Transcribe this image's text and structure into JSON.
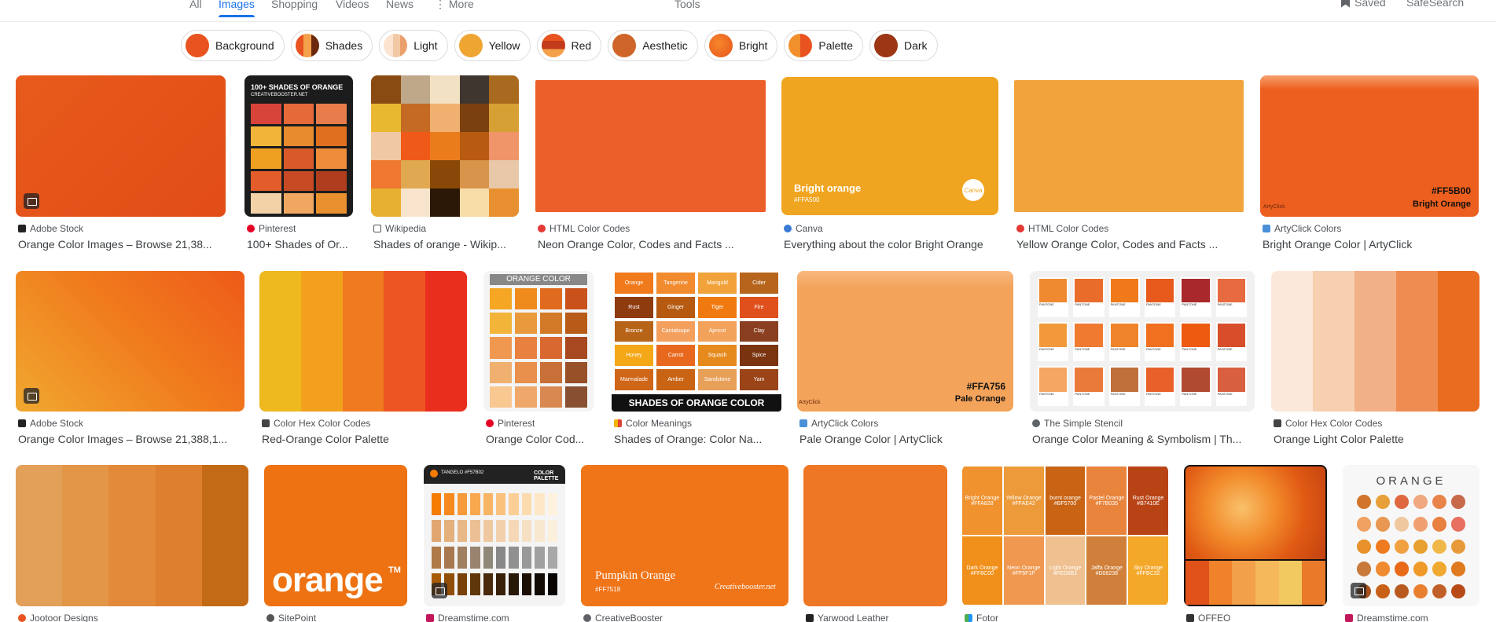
{
  "nav": {
    "tabs": [
      "All",
      "Images",
      "Shopping",
      "Videos",
      "News",
      "More"
    ],
    "active": "Images",
    "tools": "Tools",
    "saved": "Saved",
    "safesearch": "SafeSearch"
  },
  "chips": [
    {
      "label": "Background",
      "color": "#e8531f"
    },
    {
      "label": "Shades",
      "color": "#b8451b"
    },
    {
      "label": "Light",
      "color": "#f3c9a4"
    },
    {
      "label": "Yellow",
      "color": "#efa531"
    },
    {
      "label": "Red",
      "color": "#c23b1c"
    },
    {
      "label": "Aesthetic",
      "color": "#d0652a"
    },
    {
      "label": "Bright",
      "color": "#f06a1a"
    },
    {
      "label": "Palette",
      "color": "#f08f2b"
    },
    {
      "label": "Dark",
      "color": "#9c3614"
    }
  ],
  "row1": [
    {
      "source": "Adobe Stock",
      "title": "Orange Color Images – Browse 21,38...",
      "fav": "#222222"
    },
    {
      "source": "Pinterest",
      "title": "100+ Shades of Or...",
      "fav": "#e60023",
      "overlay": "100+ SHADES OF ORANGE",
      "overlay_sub": "CREATIVEBOOSTER.NET"
    },
    {
      "source": "Wikipedia",
      "title": "Shades of orange - Wikip...",
      "fav": "#555555"
    },
    {
      "source": "HTML Color Codes",
      "title": "Neon Orange Color, Codes and Facts ...",
      "fav": "#e53935"
    },
    {
      "source": "Canva",
      "title": "Everything about the color Bright Orange",
      "fav": "#3a7bd5",
      "overlay": "Bright orange",
      "overlay_sub": "#FFA500",
      "logo": "Canva"
    },
    {
      "source": "HTML Color Codes",
      "title": "Yellow Orange Color, Codes and Facts ...",
      "fav": "#e53935"
    },
    {
      "source": "ArtyClick Colors",
      "title": "Bright Orange Color | ArtyClick",
      "fav": "#4a90d9",
      "overlay": "#FF5B00",
      "overlay_sub": "Bright Orange",
      "mark": "ArtyClick"
    }
  ],
  "row2": [
    {
      "source": "Adobe Stock",
      "title": "Orange Color Images – Browse 21,388,1...",
      "fav": "#222222"
    },
    {
      "source": "Color Hex Color Codes",
      "title": "Red-Orange Color Palette",
      "fav": "#444444"
    },
    {
      "source": "Pinterest",
      "title": "Orange Color Cod...",
      "fav": "#e60023",
      "overlay": "ORANGE COLOR"
    },
    {
      "source": "Color Meanings",
      "title": "Shades of Orange: Color Na...",
      "fav": "#f4b400",
      "overlay": "SHADES OF ORANGE COLOR",
      "names": [
        "Orange",
        "Tangerine",
        "Marigold",
        "Cider",
        "Rust",
        "Ginger",
        "Tiger",
        "Fire",
        "Bronze",
        "Cantaloupe",
        "Apricot",
        "Clay",
        "Honey",
        "Carrot",
        "Squash",
        "Spice",
        "Marmalade",
        "Amber",
        "Sandstone",
        "Yam"
      ]
    },
    {
      "source": "ArtyClick Colors",
      "title": "Pale Orange Color | ArtyClick",
      "fav": "#4a90d9",
      "overlay": "#FFA756",
      "overlay_sub": "Pale Orange",
      "mark": "ArtyClick"
    },
    {
      "source": "The Simple Stencil",
      "title": "Orange Color Meaning & Symbolism | Th...",
      "fav": "#5f6368",
      "pantone": "PANTONE"
    },
    {
      "source": "Color Hex Color Codes",
      "title": "Orange Light Color Palette",
      "fav": "#444444"
    }
  ],
  "row3": [
    {
      "source": "Jootoor Designs",
      "fav": "#e8531f"
    },
    {
      "source": "SitePoint",
      "fav": "#555555",
      "overlay": "orange",
      "tm": "TM"
    },
    {
      "source": "Dreamstime.com",
      "fav": "#c2185b",
      "overlay": "TANGELO #F57B02",
      "overlay_sub": "COLOR PALETTE"
    },
    {
      "source": "CreativeBooster",
      "fav": "#5f6368",
      "overlay": "Pumpkin Orange",
      "overlay_sub": "#FF7518",
      "mark": "Creativebooster.net"
    },
    {
      "source": "Yarwood Leather",
      "fav": "#222222"
    },
    {
      "source": "Fotor",
      "fav": "#4caf50",
      "names": [
        "Bright Orange #FFA828",
        "Yellow Orange #FFAE42",
        "burnt orange #BF5700",
        "Pastel Orange #F7B035",
        "Rust Orange #B7410E",
        "Dark Orange #FF8C00",
        "Neon Orange #FF5F1F",
        "Light Orange #FED8B1",
        "Jaffa Orange #D08238",
        "Sky Orange #FFBC32"
      ]
    },
    {
      "source": "OFFEO",
      "fav": "#333333"
    },
    {
      "source": "Dreamstime.com",
      "fav": "#c2185b",
      "overlay": "ORANGE"
    }
  ]
}
